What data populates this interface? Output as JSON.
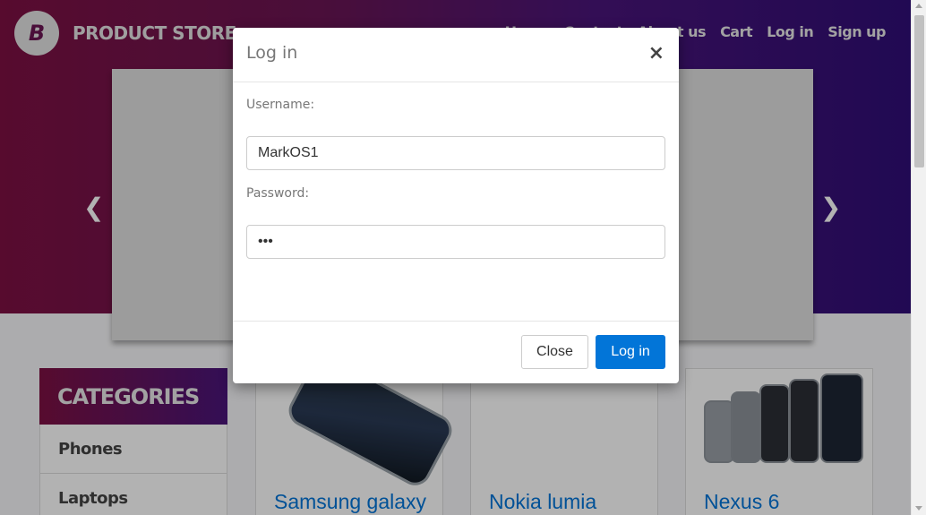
{
  "navbar": {
    "brand_mark": "B",
    "brand_name": "PRODUCT STORE",
    "links": [
      "Home",
      "Contact",
      "About us",
      "Cart",
      "Log in",
      "Sign up"
    ]
  },
  "categories": {
    "heading": "CATEGORIES",
    "items": [
      "Phones",
      "Laptops"
    ]
  },
  "products": [
    {
      "title": "Samsung galaxy",
      "image": "phone-image"
    },
    {
      "title": "Nokia lumia",
      "image": "phone-image"
    },
    {
      "title": "Nexus 6",
      "image": "phone-image"
    }
  ],
  "carousel": {
    "prev_icon": "chevron-left-icon",
    "next_icon": "chevron-right-icon"
  },
  "modal": {
    "title": "Log in",
    "close_symbol": "×",
    "username_label": "Username:",
    "username_value": "MarkOS1",
    "password_label": "Password:",
    "password_value": "•••",
    "close_button": "Close",
    "login_button": "Log in"
  },
  "colors": {
    "brand_gradient_start": "#7d1143",
    "brand_gradient_end": "#300e77",
    "primary_button": "#0275d8",
    "link_color": "#0275d8"
  }
}
